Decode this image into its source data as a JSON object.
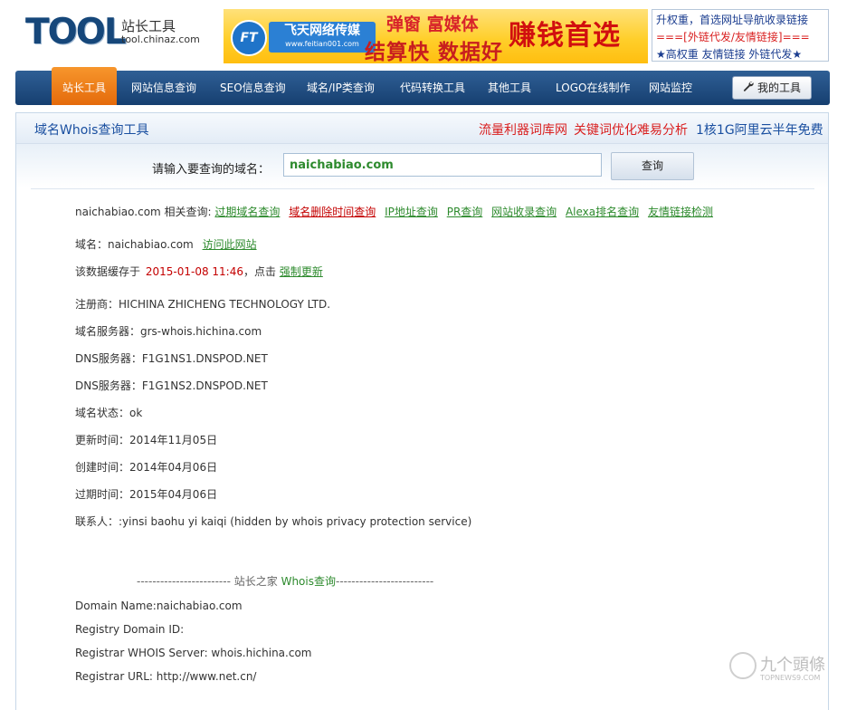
{
  "header": {
    "logo_word": "TOOL",
    "logo_cn": "站长工具",
    "logo_url": "tool.chinaz.com"
  },
  "banner": {
    "icon": "FT",
    "brand": "飞天网络传媒",
    "brand_url": "www.feitian001.com",
    "line1": "弹窗 富媒体",
    "line2": "结算快 数据好",
    "big": "赚钱首选"
  },
  "adbox": {
    "line1": "升权重，首选网址导航收录链接",
    "line2": "===[外链代发/友情链接]===",
    "line3": "★高权重 友情链接 外链代发★"
  },
  "nav": {
    "items": [
      "站长工具",
      "网站信息查询",
      "SEO信息查询",
      "域名/IP类查询",
      "代码转换工具",
      "其他工具",
      "LOGO在线制作",
      "网站监控"
    ],
    "my_tools": "我的工具"
  },
  "panel": {
    "title": "域名Whois查询工具",
    "right_links": [
      "流量利器词库网",
      "关键词优化难易分析",
      "1核1G阿里云半年免费"
    ]
  },
  "search": {
    "label": "请输入要查询的域名：",
    "value": "naichabiao.com",
    "button": "查询"
  },
  "related": {
    "prefix": "naichabiao.com 相关查询:",
    "links": [
      "过期域名查询",
      "域名删除时间查询",
      "IP地址查询",
      "PR查询",
      "网站收录查询",
      "Alexa排名查询",
      "友情链接检测"
    ]
  },
  "domain_line": {
    "label": "域名：naichabiao.com",
    "visit": "访问此网站"
  },
  "cache_line": {
    "prefix": "该数据缓存于",
    "time": "2015-01-08 11:46",
    "middle": "，点击",
    "link": "强制更新"
  },
  "fields": [
    "注册商：HICHINA ZHICHENG TECHNOLOGY LTD.",
    "域名服务器：grs-whois.hichina.com",
    "DNS服务器：F1G1NS1.DNSPOD.NET",
    "DNS服务器：F1G1NS2.DNSPOD.NET",
    "域名状态：ok",
    "更新时间：2014年11月05日",
    "创建时间：2014年04月06日",
    "过期时间：2015年04月06日",
    "联系人：:yinsi baohu yi kaiqi (hidden by whois privacy protection service)"
  ],
  "divider": {
    "left": "------------------------ 站长之家",
    "mid": "Whois查询",
    "right": "-------------------------"
  },
  "whois_raw": [
    "Domain Name:naichabiao.com",
    "Registry Domain ID:",
    "Registrar WHOIS Server: whois.hichina.com",
    "Registrar URL: http://www.net.cn/"
  ],
  "watermark": {
    "cn": "九个頭條",
    "en": "TOPNEWS9.COM"
  }
}
